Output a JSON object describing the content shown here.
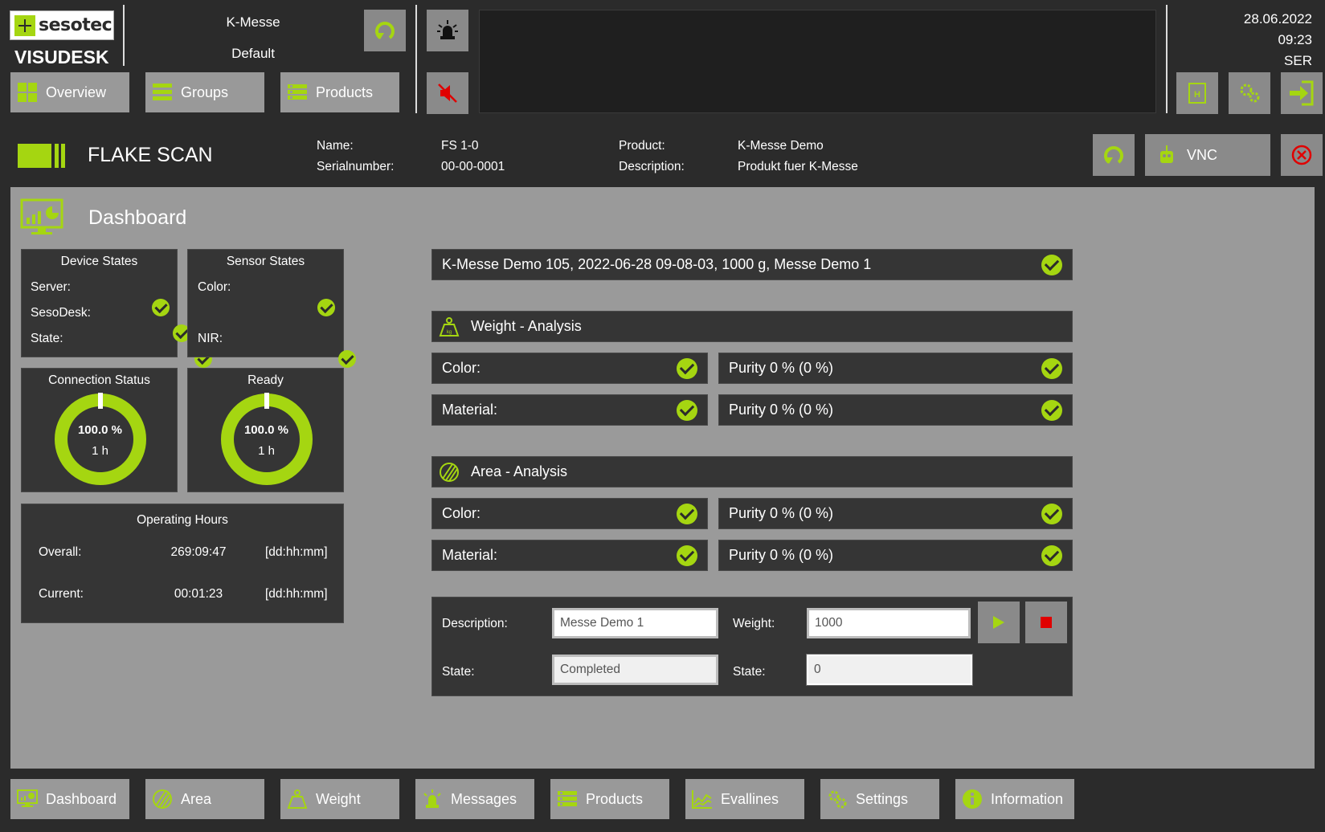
{
  "header": {
    "logo_text": "sesotec",
    "app_name": "VISUDESK",
    "line_name": "K-Messe",
    "line_profile": "Default",
    "nav": [
      {
        "label": "Overview",
        "icon": "overview-icon"
      },
      {
        "label": "Groups",
        "icon": "groups-icon"
      },
      {
        "label": "Products",
        "icon": "products-icon"
      }
    ],
    "date": "28.06.2022",
    "time": "09:23",
    "user": "SER"
  },
  "device": {
    "title": "FLAKE SCAN",
    "name_label": "Name:",
    "name": "FS 1-0",
    "serial_label": "Serialnumber:",
    "serial": "00-00-0001",
    "product_label": "Product:",
    "product": "K-Messe Demo",
    "description_label": "Description:",
    "description": "Produkt fuer K-Messe",
    "vnc_label": "VNC"
  },
  "dashboard": {
    "title": "Dashboard",
    "device_states": {
      "title": "Device States",
      "rows": [
        {
          "label": "Server:",
          "ok": true
        },
        {
          "label": "SesoDesk:",
          "ok": true
        },
        {
          "label": "State:",
          "ok": true
        }
      ]
    },
    "sensor_states": {
      "title": "Sensor States",
      "rows": [
        {
          "label": "Color:",
          "ok": true
        },
        {
          "label": "NIR:",
          "ok": true
        }
      ]
    },
    "connection_status": {
      "title": "Connection Status",
      "percent_text": "100.0 %",
      "duration": "1 h",
      "value": 100.0
    },
    "ready": {
      "title": "Ready",
      "percent_text": "100.0 %",
      "duration": "1 h",
      "value": 100.0
    },
    "operating_hours": {
      "title": "Operating Hours",
      "rows": [
        {
          "label": "Overall:",
          "value": "269:09:47",
          "unit": "[dd:hh:mm]"
        },
        {
          "label": "Current:",
          "value": "00:01:23",
          "unit": "[dd:hh:mm]"
        }
      ]
    },
    "batch": {
      "text": "K-Messe Demo 105, 2022-06-28 09-08-03, 1000 g, Messe Demo 1",
      "ok": true
    },
    "weight_analysis": {
      "title": "Weight - Analysis",
      "rows": [
        {
          "label": "Color:",
          "purity": "Purity 0 % (0 %)"
        },
        {
          "label": "Material:",
          "purity": "Purity 0 % (0 %)"
        }
      ]
    },
    "area_analysis": {
      "title": "Area - Analysis",
      "rows": [
        {
          "label": "Color:",
          "purity": "Purity 0 % (0 %)"
        },
        {
          "label": "Material:",
          "purity": "Purity 0 % (0 %)"
        }
      ]
    },
    "measurement": {
      "description_label": "Description:",
      "description_value": "Messe Demo 1",
      "weight_label": "Weight:",
      "weight_value": "1000",
      "state_label": "State:",
      "state_value": "Completed",
      "state2_label": "State:",
      "state2_value": "0"
    }
  },
  "bottom_nav": [
    {
      "label": "Dashboard",
      "icon": "dashboard-icon"
    },
    {
      "label": "Area",
      "icon": "area-icon"
    },
    {
      "label": "Weight",
      "icon": "weight-icon"
    },
    {
      "label": "Messages",
      "icon": "alarm-icon"
    },
    {
      "label": "Products",
      "icon": "products-icon"
    },
    {
      "label": "Evallines",
      "icon": "evallines-icon"
    },
    {
      "label": "Settings",
      "icon": "settings-icon"
    },
    {
      "label": "Information",
      "icon": "info-icon"
    }
  ],
  "colors": {
    "accent": "#a5d611",
    "panel": "#353535",
    "background": "#2b2b2b",
    "main": "#9a9a9a",
    "stop": "#e00000"
  }
}
